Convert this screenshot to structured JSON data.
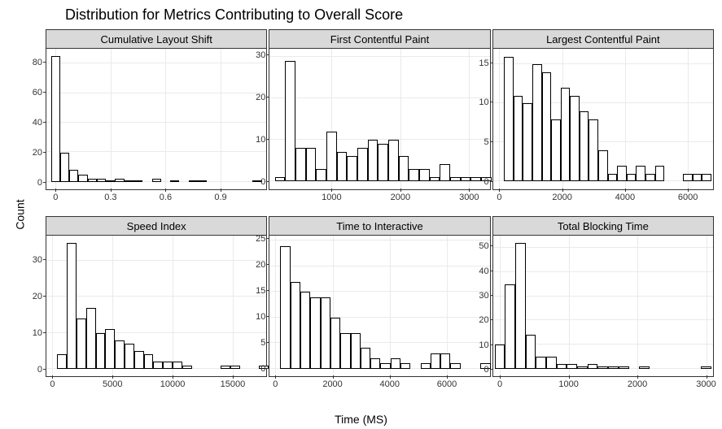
{
  "chart_data": {
    "type": "bar",
    "title": "Distribution for Metrics Contributing to Overall Score",
    "ylabel": "Count",
    "xlabel": "Time (MS)",
    "facet_layout": {
      "rows": 2,
      "cols": 3
    },
    "panels": [
      {
        "name": "Cumulative Layout Shift",
        "x_range": [
          -0.05,
          1.15
        ],
        "x_ticks": [
          0.0,
          0.3,
          0.6,
          0.9
        ],
        "y_range": [
          -5,
          90
        ],
        "y_ticks": [
          0,
          20,
          40,
          60,
          80
        ],
        "bin_width": 0.05,
        "bars": [
          {
            "x": 0.0,
            "count": 85
          },
          {
            "x": 0.05,
            "count": 20
          },
          {
            "x": 0.1,
            "count": 8
          },
          {
            "x": 0.15,
            "count": 5
          },
          {
            "x": 0.2,
            "count": 2
          },
          {
            "x": 0.25,
            "count": 2
          },
          {
            "x": 0.3,
            "count": 1
          },
          {
            "x": 0.35,
            "count": 2
          },
          {
            "x": 0.4,
            "count": 1
          },
          {
            "x": 0.45,
            "count": 1
          },
          {
            "x": 0.55,
            "count": 2
          },
          {
            "x": 0.65,
            "count": 1
          },
          {
            "x": 0.75,
            "count": 1
          },
          {
            "x": 0.8,
            "count": 1
          },
          {
            "x": 1.1,
            "count": 1
          }
        ]
      },
      {
        "name": "First Contentful Paint",
        "x_range": [
          100,
          3300
        ],
        "x_ticks": [
          1000,
          2000,
          3000
        ],
        "y_range": [
          -2,
          32
        ],
        "y_ticks": [
          0,
          10,
          20,
          30
        ],
        "bin_width": 150,
        "bars": [
          {
            "x": 250,
            "count": 1
          },
          {
            "x": 400,
            "count": 29
          },
          {
            "x": 550,
            "count": 8
          },
          {
            "x": 700,
            "count": 8
          },
          {
            "x": 850,
            "count": 3
          },
          {
            "x": 1000,
            "count": 12
          },
          {
            "x": 1150,
            "count": 7
          },
          {
            "x": 1300,
            "count": 6
          },
          {
            "x": 1450,
            "count": 8
          },
          {
            "x": 1600,
            "count": 10
          },
          {
            "x": 1750,
            "count": 9
          },
          {
            "x": 1900,
            "count": 10
          },
          {
            "x": 2050,
            "count": 6
          },
          {
            "x": 2200,
            "count": 3
          },
          {
            "x": 2350,
            "count": 3
          },
          {
            "x": 2500,
            "count": 1
          },
          {
            "x": 2650,
            "count": 4
          },
          {
            "x": 2800,
            "count": 1
          },
          {
            "x": 2950,
            "count": 1
          },
          {
            "x": 3100,
            "count": 1
          },
          {
            "x": 3250,
            "count": 1
          }
        ]
      },
      {
        "name": "Largest Contentful Paint",
        "x_range": [
          -200,
          6800
        ],
        "x_ticks": [
          0,
          2000,
          4000,
          6000
        ],
        "y_range": [
          -1,
          17
        ],
        "y_ticks": [
          0,
          5,
          10,
          15
        ],
        "bin_width": 300,
        "bars": [
          {
            "x": 300,
            "count": 16
          },
          {
            "x": 600,
            "count": 11
          },
          {
            "x": 900,
            "count": 10
          },
          {
            "x": 1200,
            "count": 15
          },
          {
            "x": 1500,
            "count": 14
          },
          {
            "x": 1800,
            "count": 8
          },
          {
            "x": 2100,
            "count": 12
          },
          {
            "x": 2400,
            "count": 11
          },
          {
            "x": 2700,
            "count": 9
          },
          {
            "x": 3000,
            "count": 8
          },
          {
            "x": 3300,
            "count": 4
          },
          {
            "x": 3600,
            "count": 1
          },
          {
            "x": 3900,
            "count": 2
          },
          {
            "x": 4200,
            "count": 1
          },
          {
            "x": 4500,
            "count": 2
          },
          {
            "x": 4800,
            "count": 1
          },
          {
            "x": 5100,
            "count": 2
          },
          {
            "x": 6000,
            "count": 1
          },
          {
            "x": 6300,
            "count": 1
          },
          {
            "x": 6600,
            "count": 1
          }
        ]
      },
      {
        "name": "Speed Index",
        "x_range": [
          -500,
          17800
        ],
        "x_ticks": [
          0,
          5000,
          10000,
          15000
        ],
        "y_range": [
          -2,
          37
        ],
        "y_ticks": [
          0,
          10,
          20,
          30
        ],
        "bin_width": 800,
        "bars": [
          {
            "x": 800,
            "count": 4
          },
          {
            "x": 1600,
            "count": 35
          },
          {
            "x": 2400,
            "count": 14
          },
          {
            "x": 3200,
            "count": 17
          },
          {
            "x": 4000,
            "count": 10
          },
          {
            "x": 4800,
            "count": 11
          },
          {
            "x": 5600,
            "count": 8
          },
          {
            "x": 6400,
            "count": 7
          },
          {
            "x": 7200,
            "count": 5
          },
          {
            "x": 8000,
            "count": 4
          },
          {
            "x": 8800,
            "count": 2
          },
          {
            "x": 9600,
            "count": 2
          },
          {
            "x": 10400,
            "count": 2
          },
          {
            "x": 11200,
            "count": 1
          },
          {
            "x": 14400,
            "count": 1
          },
          {
            "x": 15200,
            "count": 1
          },
          {
            "x": 17600,
            "count": 1
          }
        ]
      },
      {
        "name": "Time to Interactive",
        "x_range": [
          -200,
          7500
        ],
        "x_ticks": [
          0,
          2000,
          4000,
          6000
        ],
        "y_range": [
          -1.5,
          26
        ],
        "y_ticks": [
          0,
          5,
          10,
          15,
          20,
          25
        ],
        "bin_width": 350,
        "bars": [
          {
            "x": 350,
            "count": 24
          },
          {
            "x": 700,
            "count": 17
          },
          {
            "x": 1050,
            "count": 15
          },
          {
            "x": 1400,
            "count": 14
          },
          {
            "x": 1750,
            "count": 14
          },
          {
            "x": 2100,
            "count": 10
          },
          {
            "x": 2450,
            "count": 7
          },
          {
            "x": 2800,
            "count": 7
          },
          {
            "x": 3150,
            "count": 4
          },
          {
            "x": 3500,
            "count": 2
          },
          {
            "x": 3850,
            "count": 1
          },
          {
            "x": 4200,
            "count": 2
          },
          {
            "x": 4550,
            "count": 1
          },
          {
            "x": 5250,
            "count": 1
          },
          {
            "x": 5600,
            "count": 3
          },
          {
            "x": 5950,
            "count": 3
          },
          {
            "x": 6300,
            "count": 1
          },
          {
            "x": 7350,
            "count": 1
          }
        ]
      },
      {
        "name": "Total Blocking Time",
        "x_range": [
          -100,
          3100
        ],
        "x_ticks": [
          0,
          1000,
          2000,
          3000
        ],
        "y_range": [
          -3,
          55
        ],
        "y_ticks": [
          0,
          10,
          20,
          30,
          40,
          50
        ],
        "bin_width": 150,
        "bars": [
          {
            "x": 0,
            "count": 10
          },
          {
            "x": 150,
            "count": 35
          },
          {
            "x": 300,
            "count": 52
          },
          {
            "x": 450,
            "count": 14
          },
          {
            "x": 600,
            "count": 5
          },
          {
            "x": 750,
            "count": 5
          },
          {
            "x": 900,
            "count": 2
          },
          {
            "x": 1050,
            "count": 2
          },
          {
            "x": 1200,
            "count": 1
          },
          {
            "x": 1350,
            "count": 2
          },
          {
            "x": 1500,
            "count": 1
          },
          {
            "x": 1650,
            "count": 1
          },
          {
            "x": 1800,
            "count": 1
          },
          {
            "x": 2100,
            "count": 1
          },
          {
            "x": 3000,
            "count": 1
          }
        ]
      }
    ]
  }
}
